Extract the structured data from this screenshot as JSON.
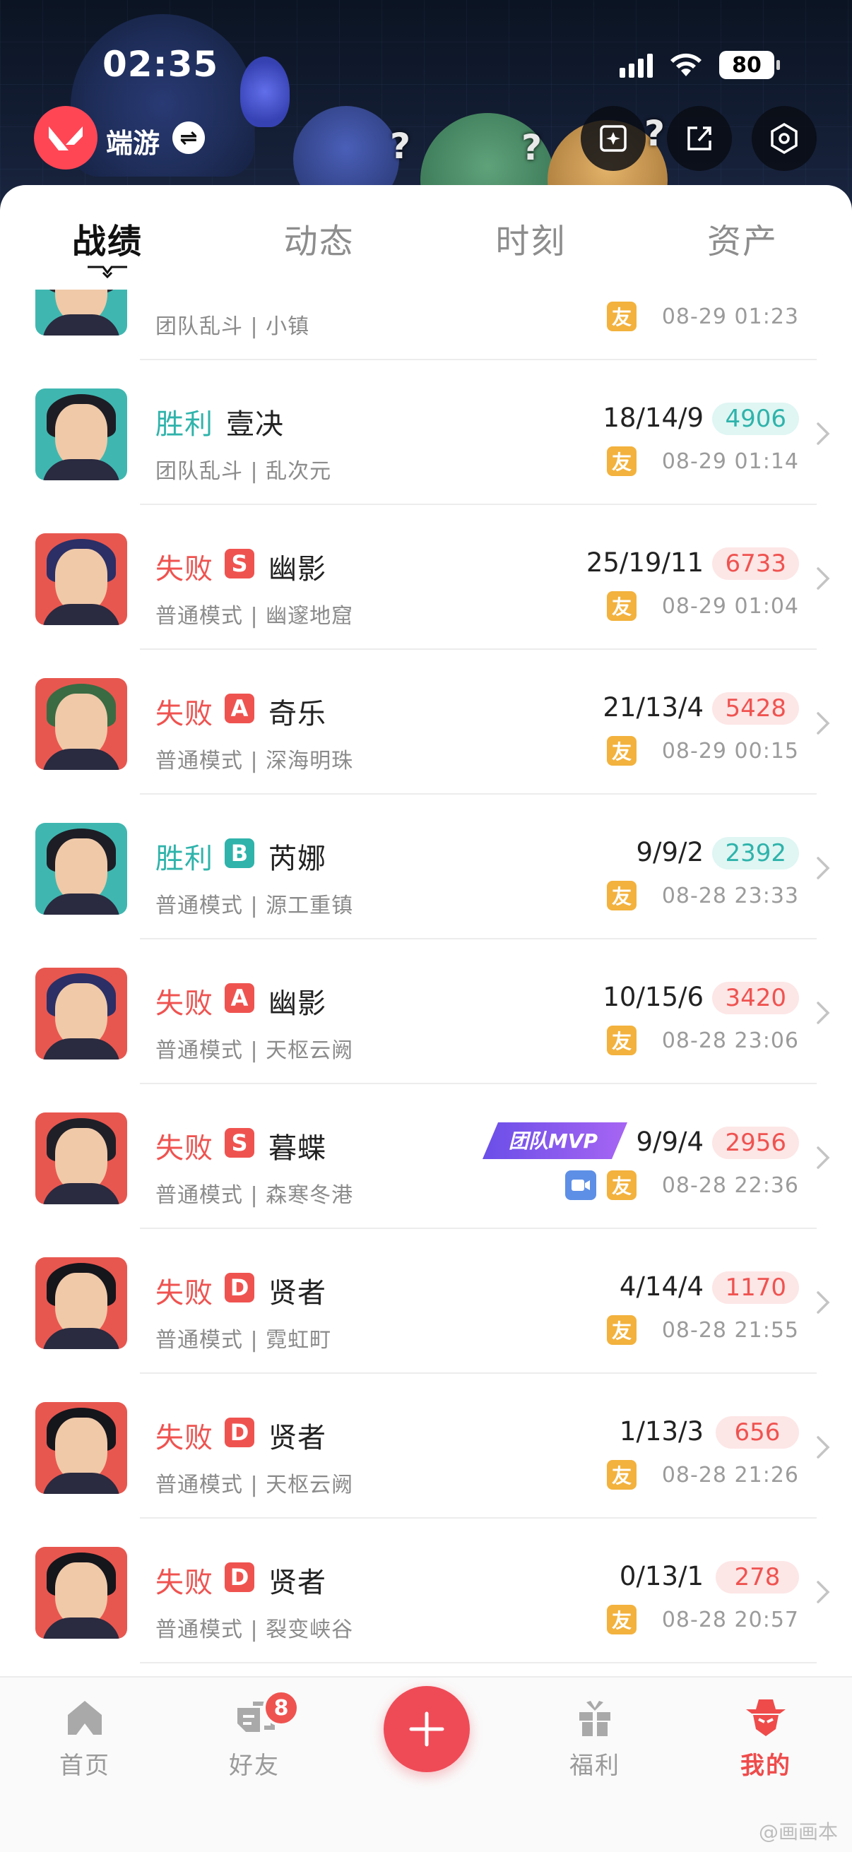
{
  "status_bar": {
    "time": "02:35",
    "battery": "80"
  },
  "header": {
    "app_name": "端游",
    "switch_icon": "switch-arrows-icon",
    "buttons": [
      "sparkle-card-icon",
      "share-icon",
      "settings-hex-icon"
    ]
  },
  "tabs": [
    {
      "label": "战绩",
      "active": true
    },
    {
      "label": "动态",
      "active": false
    },
    {
      "label": "时刻",
      "active": false
    },
    {
      "label": "资产",
      "active": false
    }
  ],
  "friend_tag": "友",
  "mvp_label": "团队MVP",
  "matches": [
    {
      "result": "",
      "rank": "",
      "agent": "",
      "mode": "团队乱斗 | 小镇",
      "kda": "",
      "score": "",
      "time": "08-29 01:23",
      "video": false,
      "mvp": false,
      "avatar_bg": "#3fb7b0"
    },
    {
      "result": "胜利",
      "rank": "",
      "agent": "壹决",
      "mode": "团队乱斗 | 乱次元",
      "kda": "18/14/9",
      "score": "4906",
      "time": "08-29 01:14",
      "video": false,
      "mvp": false,
      "avatar_bg": "#3fb7b0"
    },
    {
      "result": "失败",
      "rank": "S",
      "agent": "幽影",
      "mode": "普通模式 | 幽邃地窟",
      "kda": "25/19/11",
      "score": "6733",
      "time": "08-29 01:04",
      "video": false,
      "mvp": false,
      "avatar_bg": "#e8574f"
    },
    {
      "result": "失败",
      "rank": "A",
      "agent": "奇乐",
      "mode": "普通模式 | 深海明珠",
      "kda": "21/13/4",
      "score": "5428",
      "time": "08-29 00:15",
      "video": false,
      "mvp": false,
      "avatar_bg": "#e8574f"
    },
    {
      "result": "胜利",
      "rank": "B",
      "agent": "芮娜",
      "mode": "普通模式 | 源工重镇",
      "kda": "9/9/2",
      "score": "2392",
      "time": "08-28 23:33",
      "video": false,
      "mvp": false,
      "avatar_bg": "#3fb7b0"
    },
    {
      "result": "失败",
      "rank": "A",
      "agent": "幽影",
      "mode": "普通模式 | 天枢云阙",
      "kda": "10/15/6",
      "score": "3420",
      "time": "08-28 23:06",
      "video": false,
      "mvp": false,
      "avatar_bg": "#e8574f"
    },
    {
      "result": "失败",
      "rank": "S",
      "agent": "暮蝶",
      "mode": "普通模式 | 森寒冬港",
      "kda": "9/9/4",
      "score": "2956",
      "time": "08-28 22:36",
      "video": true,
      "mvp": true,
      "avatar_bg": "#e8574f"
    },
    {
      "result": "失败",
      "rank": "D",
      "agent": "贤者",
      "mode": "普通模式 | 霓虹町",
      "kda": "4/14/4",
      "score": "1170",
      "time": "08-28 21:55",
      "video": false,
      "mvp": false,
      "avatar_bg": "#e8574f"
    },
    {
      "result": "失败",
      "rank": "D",
      "agent": "贤者",
      "mode": "普通模式 | 天枢云阙",
      "kda": "1/13/3",
      "score": "656",
      "time": "08-28 21:26",
      "video": false,
      "mvp": false,
      "avatar_bg": "#e8574f"
    },
    {
      "result": "失败",
      "rank": "D",
      "agent": "贤者",
      "mode": "普通模式 | 裂变峡谷",
      "kda": "0/13/1",
      "score": "278",
      "time": "08-28 20:57",
      "video": false,
      "mvp": false,
      "avatar_bg": "#e8574f"
    }
  ],
  "bottom_nav": [
    {
      "label": "首页",
      "icon": "home-icon",
      "active": false,
      "badge": ""
    },
    {
      "label": "好友",
      "icon": "friends-icon",
      "active": false,
      "badge": "8"
    },
    {
      "label": "",
      "icon": "plus-icon",
      "active": false,
      "badge": ""
    },
    {
      "label": "福利",
      "icon": "gift-icon",
      "active": false,
      "badge": ""
    },
    {
      "label": "我的",
      "icon": "profile-agent-icon",
      "active": true,
      "badge": ""
    }
  ],
  "watermark": "@画画本",
  "colors": {
    "win": "#2fb3ab",
    "lose": "#ef5350",
    "accent": "#ef4b57",
    "friend_tag": "#f3b23d"
  }
}
